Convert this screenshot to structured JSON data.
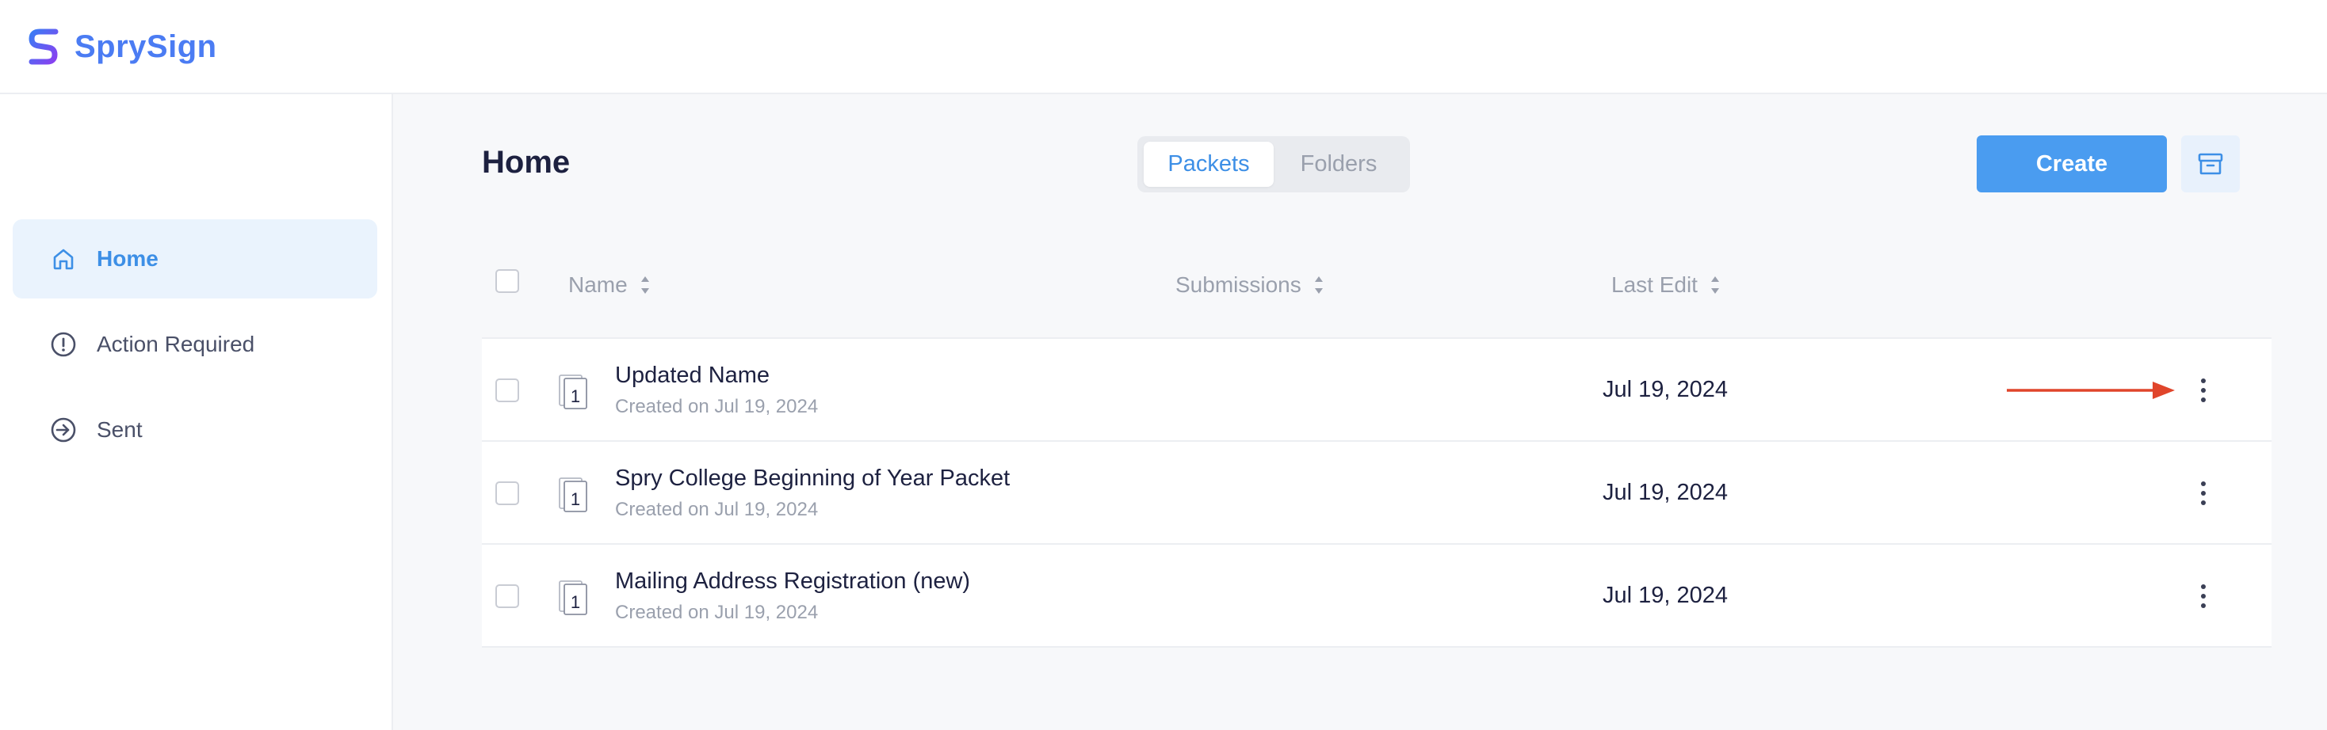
{
  "app": {
    "name": "SprySign",
    "brand_color": "#4b7cf3",
    "accent_color": "#4a9cf0"
  },
  "sidebar": {
    "items": [
      {
        "label": "Home",
        "icon": "home-icon",
        "active": true
      },
      {
        "label": "Action Required",
        "icon": "alert-circle-icon",
        "active": false
      },
      {
        "label": "Sent",
        "icon": "sent-arrow-icon",
        "active": false
      }
    ]
  },
  "main": {
    "title": "Home",
    "tabs": [
      {
        "label": "Packets",
        "active": true
      },
      {
        "label": "Folders",
        "active": false
      }
    ],
    "create_label": "Create",
    "archive_icon": "archive-icon"
  },
  "table": {
    "columns": [
      "Name",
      "Submissions",
      "Last Edit"
    ],
    "rows": [
      {
        "title": "Updated Name",
        "created": "Created on Jul 19, 2024",
        "doc_count": "1",
        "last_edit": "Jul 19, 2024",
        "highlighted": true
      },
      {
        "title": "Spry College Beginning of Year Packet",
        "created": "Created on Jul 19, 2024",
        "doc_count": "1",
        "last_edit": "Jul 19, 2024",
        "highlighted": false
      },
      {
        "title": "Mailing Address Registration (new)",
        "created": "Created on Jul 19, 2024",
        "doc_count": "1",
        "last_edit": "Jul 19, 2024",
        "highlighted": false
      }
    ]
  },
  "annotation": {
    "arrow_color": "#e0452b"
  }
}
